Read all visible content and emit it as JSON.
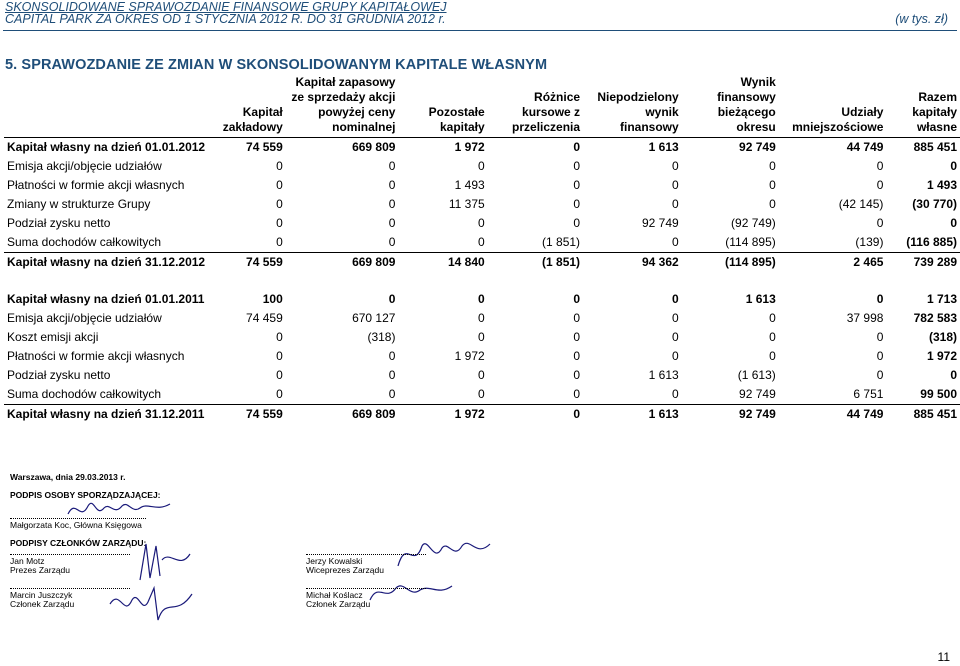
{
  "header": {
    "line1": "SKONSOLIDOWANE SPRAWOZDANIE FINANSOWE GRUPY KAPITAŁOWEJ",
    "line2": "CAPITAL PARK ZA OKRES OD 1 STYCZNIA 2012 R. DO 31 GRUDNIA 2012 r.",
    "unit": "(w tys. zł)"
  },
  "section_title": "5.  SPRAWOZDANIE ZE ZMIAN W SKONSOLIDOWANYM KAPITALE WŁASNYM",
  "columns": [
    "",
    "Kapitał zakładowy",
    "Kapitał zapasowy ze sprzedaży akcji powyżej ceny nominalnej",
    "Pozostałe kapitały",
    "Różnice kursowe z przeliczenia",
    "Niepodzielony wynik finansowy",
    "Wynik finansowy bieżącego okresu",
    "Udziały mniejszościowe",
    "Razem kapitały własne"
  ],
  "rows": [
    {
      "type": "total",
      "label": "Kapitał własny na dzień 01.01.2012",
      "values": [
        "74 559",
        "669 809",
        "1 972",
        "0",
        "1 613",
        "92 749",
        "44 749",
        "885 451"
      ]
    },
    {
      "type": "item",
      "label": "Emisja akcji/objęcie udziałów",
      "values": [
        "0",
        "0",
        "0",
        "0",
        "0",
        "0",
        "0",
        "0"
      ]
    },
    {
      "type": "item",
      "label": "Płatności w formie akcji własnych",
      "values": [
        "0",
        "0",
        "1 493",
        "0",
        "0",
        "0",
        "0",
        "1 493"
      ]
    },
    {
      "type": "item",
      "label": "Zmiany w strukturze Grupy",
      "values": [
        "0",
        "0",
        "11 375",
        "0",
        "0",
        "0",
        "(42 145)",
        "(30 770)"
      ]
    },
    {
      "type": "item",
      "label": "Podział zysku netto",
      "values": [
        "0",
        "0",
        "0",
        "0",
        "92 749",
        "(92 749)",
        "0",
        "0"
      ]
    },
    {
      "type": "item",
      "label": "Suma dochodów całkowitych",
      "values": [
        "0",
        "0",
        "0",
        "(1 851)",
        "0",
        "(114 895)",
        "(139)",
        "(116 885)"
      ]
    },
    {
      "type": "total-end",
      "label": "Kapitał własny na dzień 31.12.2012",
      "values": [
        "74 559",
        "669 809",
        "14 840",
        "(1 851)",
        "94 362",
        "(114 895)",
        "2 465",
        "739 289"
      ]
    },
    {
      "type": "space"
    },
    {
      "type": "total",
      "label": "Kapitał własny na dzień 01.01.2011",
      "values": [
        "100",
        "0",
        "0",
        "0",
        "0",
        "1 613",
        "0",
        "1 713"
      ]
    },
    {
      "type": "item",
      "label": "Emisja akcji/objęcie udziałów",
      "values": [
        "74 459",
        "670 127",
        "0",
        "0",
        "0",
        "0",
        "37 998",
        "782 583"
      ]
    },
    {
      "type": "item",
      "label": "Koszt emisji akcji",
      "values": [
        "0",
        "(318)",
        "0",
        "0",
        "0",
        "0",
        "0",
        "(318)"
      ]
    },
    {
      "type": "item",
      "label": "Płatności w formie akcji własnych",
      "values": [
        "0",
        "0",
        "1 972",
        "0",
        "0",
        "0",
        "0",
        "1 972"
      ]
    },
    {
      "type": "item",
      "label": "Podział zysku netto",
      "values": [
        "0",
        "0",
        "0",
        "0",
        "1 613",
        "(1 613)",
        "0",
        "0"
      ]
    },
    {
      "type": "item",
      "label": "Suma dochodów całkowitych",
      "values": [
        "0",
        "0",
        "0",
        "0",
        "0",
        "92 749",
        "6 751",
        "99 500"
      ]
    },
    {
      "type": "total-end",
      "label": "Kapitał własny na dzień 31.12.2011",
      "values": [
        "74 559",
        "669 809",
        "1 972",
        "0",
        "1 613",
        "92 749",
        "44 749",
        "885 451"
      ]
    }
  ],
  "signatures": {
    "place_date": "Warszawa, dnia 29.03.2013 r.",
    "prep_heading": "PODPIS OSOBY SPORZĄDZAJĄCEJ:",
    "prep_name": "Małgorzata Koc, Główna Księgowa",
    "board_heading": "PODPISY CZŁONKÓW ZARZĄDU:",
    "m1_name": "Jan Motz",
    "m1_role": "Prezes Zarządu",
    "m2_name": "Marcin Juszczyk",
    "m2_role": "Członek Zarządu",
    "m3_name": "Jerzy Kowalski",
    "m3_role": "Wiceprezes Zarządu",
    "m4_name": "Michał Koślacz",
    "m4_role": "Członek Zarządu"
  },
  "page_number": "11"
}
